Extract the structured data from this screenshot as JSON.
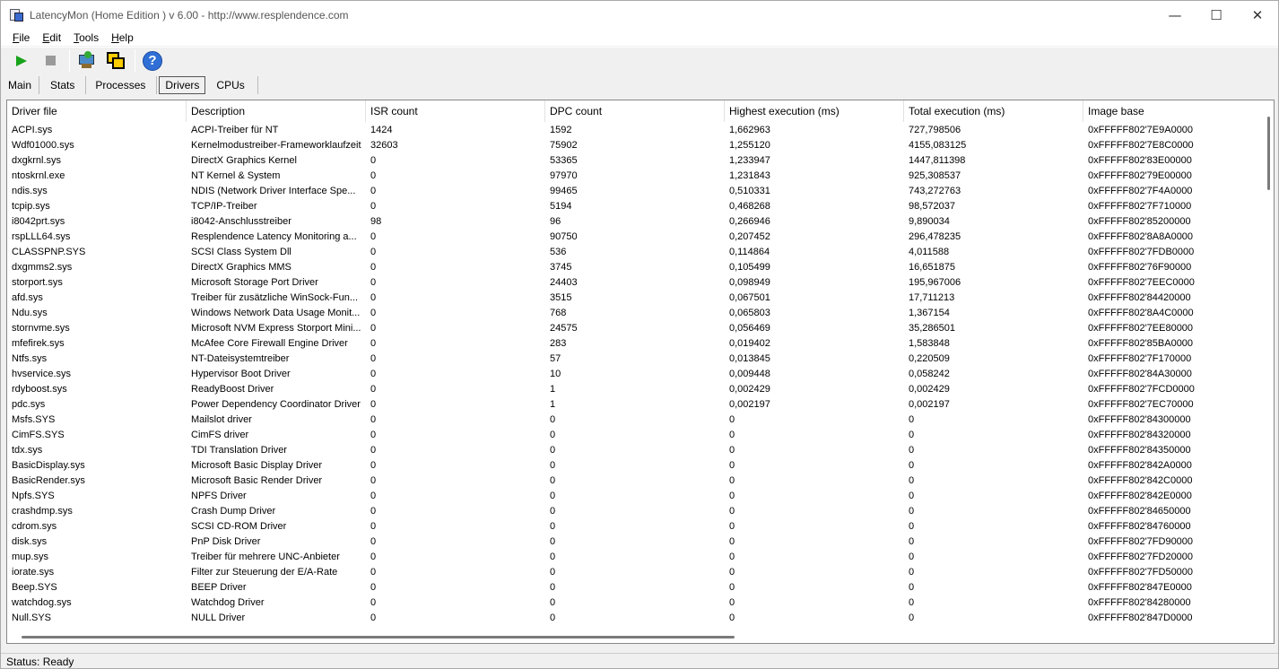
{
  "window": {
    "title": "LatencyMon  (Home Edition )  v 6.00 - http://www.resplendence.com",
    "minimize": "—",
    "maximize": "☐",
    "close": "✕"
  },
  "menu": [
    {
      "label": "File",
      "accel": "F",
      "rest": "ile"
    },
    {
      "label": "Edit",
      "accel": "E",
      "rest": "dit"
    },
    {
      "label": "Tools",
      "accel": "T",
      "rest": "ools"
    },
    {
      "label": "Help",
      "accel": "H",
      "rest": "elp"
    }
  ],
  "toolbar": {
    "icons": [
      "play-icon",
      "stop-icon",
      "tool-icon",
      "window-icon",
      "help-icon"
    ],
    "help_glyph": "?"
  },
  "tabs": [
    "Main",
    "Stats",
    "Processes",
    "Drivers",
    "CPUs"
  ],
  "active_tab": "Drivers",
  "table": {
    "columns": [
      "Driver file",
      "Description",
      "ISR count",
      "DPC count",
      "Highest execution (ms)",
      "Total execution (ms)",
      "Image base"
    ],
    "rows": [
      [
        "ACPI.sys",
        "ACPI-Treiber für NT",
        "1424",
        "1592",
        "1,662963",
        "727,798506",
        "0xFFFFF802'7E9A0000"
      ],
      [
        "Wdf01000.sys",
        "Kernelmodustreiber-Frameworklaufzeit",
        "32603",
        "75902",
        "1,255120",
        "4155,083125",
        "0xFFFFF802'7E8C0000"
      ],
      [
        "dxgkrnl.sys",
        "DirectX Graphics Kernel",
        "0",
        "53365",
        "1,233947",
        "1447,811398",
        "0xFFFFF802'83E00000"
      ],
      [
        "ntoskrnl.exe",
        "NT Kernel & System",
        "0",
        "97970",
        "1,231843",
        "925,308537",
        "0xFFFFF802'79E00000"
      ],
      [
        "ndis.sys",
        "NDIS (Network Driver Interface Spe...",
        "0",
        "99465",
        "0,510331",
        "743,272763",
        "0xFFFFF802'7F4A0000"
      ],
      [
        "tcpip.sys",
        "TCP/IP-Treiber",
        "0",
        "5194",
        "0,468268",
        "98,572037",
        "0xFFFFF802'7F710000"
      ],
      [
        "i8042prt.sys",
        "i8042-Anschlusstreiber",
        "98",
        "96",
        "0,266946",
        "9,890034",
        "0xFFFFF802'85200000"
      ],
      [
        "rspLLL64.sys",
        "Resplendence Latency Monitoring a...",
        "0",
        "90750",
        "0,207452",
        "296,478235",
        "0xFFFFF802'8A8A0000"
      ],
      [
        "CLASSPNP.SYS",
        "SCSI Class System Dll",
        "0",
        "536",
        "0,114864",
        "4,011588",
        "0xFFFFF802'7FDB0000"
      ],
      [
        "dxgmms2.sys",
        "DirectX Graphics MMS",
        "0",
        "3745",
        "0,105499",
        "16,651875",
        "0xFFFFF802'76F90000"
      ],
      [
        "storport.sys",
        "Microsoft Storage Port Driver",
        "0",
        "24403",
        "0,098949",
        "195,967006",
        "0xFFFFF802'7EEC0000"
      ],
      [
        "afd.sys",
        "Treiber für zusätzliche WinSock-Fun...",
        "0",
        "3515",
        "0,067501",
        "17,711213",
        "0xFFFFF802'84420000"
      ],
      [
        "Ndu.sys",
        "Windows Network Data Usage Monit...",
        "0",
        "768",
        "0,065803",
        "1,367154",
        "0xFFFFF802'8A4C0000"
      ],
      [
        "stornvme.sys",
        "Microsoft NVM Express Storport Mini...",
        "0",
        "24575",
        "0,056469",
        "35,286501",
        "0xFFFFF802'7EE80000"
      ],
      [
        "mfefirek.sys",
        "McAfee Core Firewall Engine Driver",
        "0",
        "283",
        "0,019402",
        "1,583848",
        "0xFFFFF802'85BA0000"
      ],
      [
        "Ntfs.sys",
        "NT-Dateisystemtreiber",
        "0",
        "57",
        "0,013845",
        "0,220509",
        "0xFFFFF802'7F170000"
      ],
      [
        "hvservice.sys",
        "Hypervisor Boot Driver",
        "0",
        "10",
        "0,009448",
        "0,058242",
        "0xFFFFF802'84A30000"
      ],
      [
        "rdyboost.sys",
        "ReadyBoost Driver",
        "0",
        "1",
        "0,002429",
        "0,002429",
        "0xFFFFF802'7FCD0000"
      ],
      [
        "pdc.sys",
        "Power Dependency Coordinator Driver",
        "0",
        "1",
        "0,002197",
        "0,002197",
        "0xFFFFF802'7EC70000"
      ],
      [
        "Msfs.SYS",
        "Mailslot driver",
        "0",
        "0",
        "0",
        "0",
        "0xFFFFF802'84300000"
      ],
      [
        "CimFS.SYS",
        "CimFS driver",
        "0",
        "0",
        "0",
        "0",
        "0xFFFFF802'84320000"
      ],
      [
        "tdx.sys",
        "TDI Translation Driver",
        "0",
        "0",
        "0",
        "0",
        "0xFFFFF802'84350000"
      ],
      [
        "BasicDisplay.sys",
        "Microsoft Basic Display Driver",
        "0",
        "0",
        "0",
        "0",
        "0xFFFFF802'842A0000"
      ],
      [
        "BasicRender.sys",
        "Microsoft Basic Render Driver",
        "0",
        "0",
        "0",
        "0",
        "0xFFFFF802'842C0000"
      ],
      [
        "Npfs.SYS",
        "NPFS Driver",
        "0",
        "0",
        "0",
        "0",
        "0xFFFFF802'842E0000"
      ],
      [
        "crashdmp.sys",
        "Crash Dump Driver",
        "0",
        "0",
        "0",
        "0",
        "0xFFFFF802'84650000"
      ],
      [
        "cdrom.sys",
        "SCSI CD-ROM Driver",
        "0",
        "0",
        "0",
        "0",
        "0xFFFFF802'84760000"
      ],
      [
        "disk.sys",
        "PnP Disk Driver",
        "0",
        "0",
        "0",
        "0",
        "0xFFFFF802'7FD90000"
      ],
      [
        "mup.sys",
        "Treiber für mehrere UNC-Anbieter",
        "0",
        "0",
        "0",
        "0",
        "0xFFFFF802'7FD20000"
      ],
      [
        "iorate.sys",
        "Filter zur Steuerung der E/A-Rate",
        "0",
        "0",
        "0",
        "0",
        "0xFFFFF802'7FD50000"
      ],
      [
        "Beep.SYS",
        "BEEP Driver",
        "0",
        "0",
        "0",
        "0",
        "0xFFFFF802'847E0000"
      ],
      [
        "watchdog.sys",
        "Watchdog Driver",
        "0",
        "0",
        "0",
        "0",
        "0xFFFFF802'84280000"
      ],
      [
        "Null.SYS",
        "NULL Driver",
        "0",
        "0",
        "0",
        "0",
        "0xFFFFF802'847D0000"
      ]
    ]
  },
  "status": "Status: Ready"
}
